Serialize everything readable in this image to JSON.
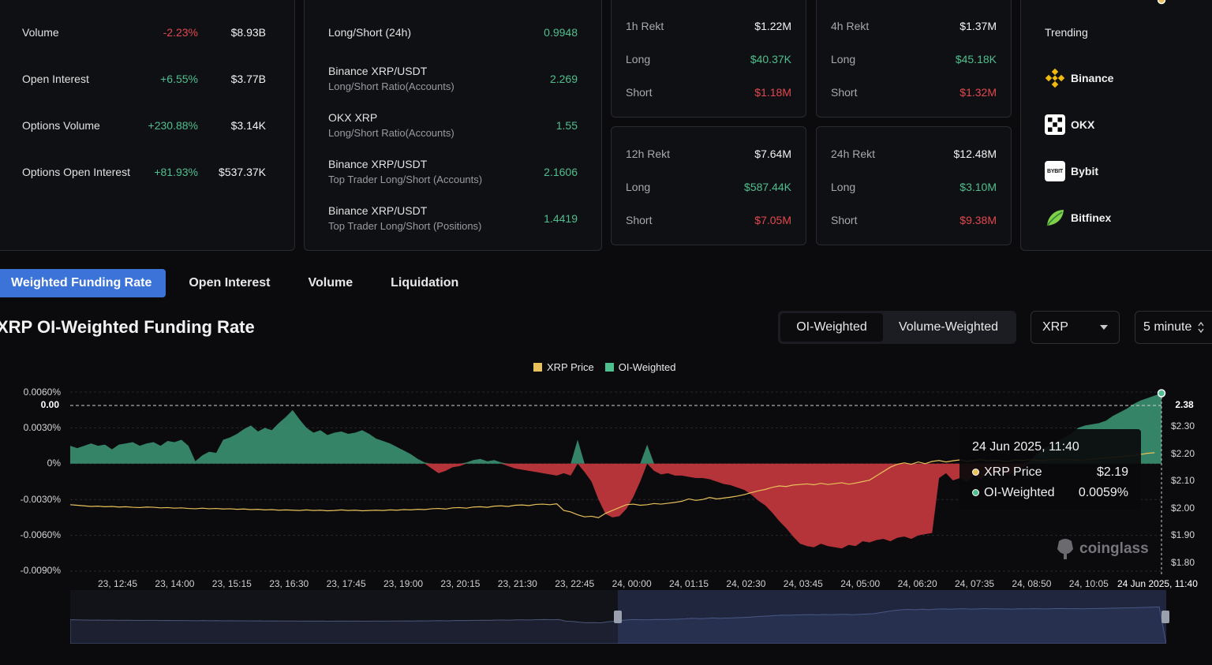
{
  "stats": [
    {
      "label": "Volume",
      "change": "-2.23%",
      "change_color": "red",
      "value": "$8.93B"
    },
    {
      "label": "Open Interest",
      "change": "+6.55%",
      "change_color": "green",
      "value": "$3.77B"
    },
    {
      "label": "Options Volume",
      "change": "+230.88%",
      "change_color": "green",
      "value": "$3.14K"
    },
    {
      "label": "Options Open Interest",
      "change": "+81.93%",
      "change_color": "green",
      "value": "$537.37K"
    }
  ],
  "ratios": [
    {
      "title": "Long/Short (24h)",
      "subtitle": "",
      "value": "0.9948"
    },
    {
      "title": "Binance XRP/USDT",
      "subtitle": "Long/Short Ratio(Accounts)",
      "value": "2.269"
    },
    {
      "title": "OKX XRP",
      "subtitle": "Long/Short Ratio(Accounts)",
      "value": "1.55"
    },
    {
      "title": "Binance XRP/USDT",
      "subtitle": "Top Trader Long/Short (Accounts)",
      "value": "2.1606"
    },
    {
      "title": "Binance XRP/USDT",
      "subtitle": "Top Trader Long/Short (Positions)",
      "value": "1.4419"
    }
  ],
  "rekt": [
    {
      "title": "1h Rekt",
      "total": "$1.22M",
      "long_label": "Long",
      "long": "$40.37K",
      "short_label": "Short",
      "short": "$1.18M"
    },
    {
      "title": "4h Rekt",
      "total": "$1.37M",
      "long_label": "Long",
      "long": "$45.18K",
      "short_label": "Short",
      "short": "$1.32M"
    },
    {
      "title": "12h Rekt",
      "total": "$7.64M",
      "long_label": "Long",
      "long": "$587.44K",
      "short_label": "Short",
      "short": "$7.05M"
    },
    {
      "title": "24h Rekt",
      "total": "$12.48M",
      "long_label": "Long",
      "long": "$3.10M",
      "short_label": "Short",
      "short": "$9.38M"
    }
  ],
  "trending": {
    "title": "Trending",
    "items": [
      {
        "name": "Binance",
        "icon": "binance-icon"
      },
      {
        "name": "OKX",
        "icon": "okx-icon"
      },
      {
        "name": "Bybit",
        "icon": "bybit-icon",
        "logo_text": "BYBIT"
      },
      {
        "name": "Bitfinex",
        "icon": "bitfinex-icon"
      }
    ]
  },
  "tabs": [
    "Weighted Funding Rate",
    "Open Interest",
    "Volume",
    "Liquidation"
  ],
  "chart_title": "XRP OI-Weighted Funding Rate",
  "segment": {
    "on": "OI-Weighted",
    "off": "Volume-Weighted"
  },
  "coin_select": {
    "value": "XRP"
  },
  "interval_select": {
    "value": "5 minute"
  },
  "tooltip": {
    "date": "24 Jun 2025, 11:40",
    "rows": [
      {
        "label": "XRP Price",
        "value": "$2.19"
      },
      {
        "label": "OI-Weighted",
        "value": "0.0059%"
      }
    ]
  },
  "crosshair": {
    "left_value": "0.00",
    "right_value": "2.38"
  },
  "watermark": "coinglass",
  "colors": {
    "green": "#4fbf8f",
    "red": "#e2484f",
    "accent": "#3b73d9",
    "price_line": "#e8c15a",
    "area_green": "#3e9a78",
    "area_red": "#c7393f"
  },
  "chart_data": {
    "type": "area",
    "legend": [
      "XRP Price",
      "OI-Weighted"
    ],
    "x_ticks": [
      "23, 12:45",
      "23, 14:00",
      "23, 15:15",
      "23, 16:30",
      "23, 17:45",
      "23, 19:00",
      "23, 20:15",
      "23, 21:30",
      "23, 22:45",
      "24, 00:00",
      "24, 01:15",
      "24, 02:30",
      "24, 03:45",
      "24, 05:00",
      "24, 06:20",
      "24, 07:35",
      "24, 08:50",
      "24, 10:05"
    ],
    "x_last_label": "24 Jun 2025, 11:40",
    "y_left_ticks": [
      "0.0060%",
      "0.0030%",
      "0%",
      "-0.0030%",
      "-0.0060%",
      "-0.0090%"
    ],
    "y_left_range": [
      -0.009,
      0.006
    ],
    "y_right_ticks": [
      "$2.30",
      "$2.20",
      "$2.10",
      "$2.00",
      "$1.90",
      "$1.80"
    ],
    "y_right_range": [
      1.78,
      2.4
    ],
    "series": [
      {
        "name": "OI-Weighted",
        "unit": "%",
        "values": [
          0.0015,
          0.0013,
          0.0015,
          0.0017,
          0.0015,
          0.0016,
          0.0012,
          0.0016,
          0.0017,
          0.0018,
          0.0015,
          0.0017,
          0.0018,
          0.0015,
          0.0019,
          0.0018,
          0.002,
          0.0015,
          0.0002,
          0.0007,
          0.001,
          0.0009,
          0.002,
          0.0022,
          0.0025,
          0.0029,
          0.0032,
          0.0027,
          0.003,
          0.0028,
          0.0034,
          0.0039,
          0.0045,
          0.0037,
          0.003,
          0.0026,
          0.0028,
          0.0024,
          0.0026,
          0.0027,
          0.0025,
          0.0026,
          0.0028,
          0.0025,
          0.0021,
          0.0019,
          0.0017,
          0.0014,
          0.0011,
          0.0008,
          0.0004,
          0.0001,
          -0.0004,
          -0.0008,
          -0.0006,
          -0.0003,
          -0.0002,
          0.0001,
          0.0003,
          0.0004,
          0.0002,
          0.0003,
          0.0001,
          -0.0002,
          -0.0004,
          -0.0005,
          -0.0006,
          -0.0007,
          -0.0008,
          -0.0009,
          -0.001,
          -0.0008,
          -0.001,
          0.002,
          -0.0007,
          -0.0015,
          -0.003,
          -0.0042,
          -0.0045,
          -0.0044,
          -0.0038,
          -0.0028,
          -0.0015,
          0.0016,
          -0.0006,
          -0.0009,
          -0.0008,
          -0.001,
          -0.001,
          -0.0011,
          -0.0012,
          -0.0012,
          -0.0013,
          -0.0015,
          -0.0017,
          -0.0018,
          -0.002,
          -0.0022,
          -0.0026,
          -0.0031,
          -0.0035,
          -0.0041,
          -0.0048,
          -0.0054,
          -0.0061,
          -0.0067,
          -0.0069,
          -0.007,
          -0.0067,
          -0.0069,
          -0.007,
          -0.0071,
          -0.0068,
          -0.0069,
          -0.0065,
          -0.0066,
          -0.0064,
          -0.0063,
          -0.0065,
          -0.0062,
          -0.0061,
          -0.0063,
          -0.006,
          -0.0059,
          -0.0058,
          -0.0012,
          -0.0008,
          -0.0014,
          -0.0012,
          -0.0015,
          -0.001,
          -0.0013,
          -0.0008,
          -0.0009,
          -0.0006,
          -0.001,
          -0.0005,
          -0.0003,
          0.0002,
          0.0008,
          0.0013,
          0.0015,
          0.0019,
          0.0022,
          0.0025,
          0.003,
          0.0032,
          0.0033,
          0.0034,
          0.0036,
          0.004,
          0.0043,
          0.0046,
          0.005,
          0.0053,
          0.0055,
          0.0057,
          0.0059
        ]
      },
      {
        "name": "XRP Price",
        "unit": "$",
        "values": [
          2.01,
          2.008,
          2.006,
          2.004,
          2.005,
          2.003,
          2.004,
          2.002,
          2.003,
          2.001,
          2.0,
          2.002,
          2.001,
          1.999,
          2.0,
          1.998,
          1.999,
          1.997,
          1.996,
          1.998,
          1.996,
          1.997,
          1.995,
          1.996,
          1.994,
          1.995,
          1.993,
          1.994,
          1.992,
          1.993,
          1.991,
          1.992,
          1.991,
          1.99,
          1.992,
          1.99,
          1.991,
          1.989,
          1.99,
          1.992,
          1.99,
          1.991,
          1.989,
          1.99,
          1.991,
          1.99,
          1.992,
          1.991,
          1.993,
          1.992,
          1.994,
          1.993,
          1.996,
          1.997,
          1.995,
          1.999,
          2.0,
          1.998,
          2.002,
          2.003,
          2.001,
          2.005,
          2.006,
          2.004,
          2.008,
          2.009,
          2.007,
          2.011,
          2.012,
          2.01,
          2.013,
          1.99,
          1.985,
          1.975,
          1.968,
          1.97,
          1.965,
          1.98,
          1.99,
          2.0,
          2.01,
          2.012,
          2.008,
          2.01,
          2.014,
          2.012,
          2.015,
          2.018,
          2.022,
          2.03,
          2.025,
          2.028,
          2.035,
          2.03,
          2.033,
          2.036,
          2.04,
          2.045,
          2.052,
          2.058,
          2.063,
          2.07,
          2.075,
          2.073,
          2.078,
          2.08,
          2.082,
          2.079,
          2.084,
          2.08,
          2.083,
          2.086,
          2.081,
          2.085,
          2.09,
          2.095,
          2.11,
          2.125,
          2.14,
          2.15,
          2.155,
          2.15,
          2.158,
          2.152,
          2.16,
          2.163,
          2.158,
          2.162,
          2.165,
          2.16,
          2.163,
          2.166,
          2.162,
          2.164,
          2.162,
          2.16,
          2.165,
          2.163,
          2.166,
          2.164,
          2.162,
          2.166,
          2.168,
          2.165,
          2.167,
          2.164,
          2.166,
          2.168,
          2.17,
          2.172,
          2.174,
          2.176,
          2.178,
          2.18,
          2.184,
          2.188,
          2.19
        ]
      }
    ]
  }
}
